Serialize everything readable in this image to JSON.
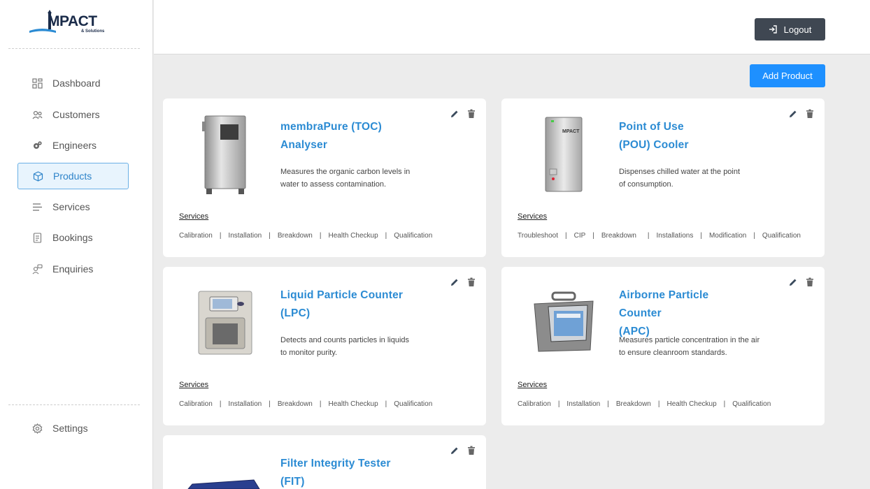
{
  "brand": {
    "name": "MPACT",
    "tagline": "& Solutions"
  },
  "sidebar": {
    "items": [
      {
        "label": "Dashboard",
        "icon": "grid-icon"
      },
      {
        "label": "Customers",
        "icon": "users-icon"
      },
      {
        "label": "Engineers",
        "icon": "gears-icon"
      },
      {
        "label": "Products",
        "icon": "box-icon",
        "active": true
      },
      {
        "label": "Services",
        "icon": "list-icon"
      },
      {
        "label": "Bookings",
        "icon": "document-icon"
      },
      {
        "label": "Enquiries",
        "icon": "chat-user-icon"
      }
    ],
    "settings": {
      "label": "Settings",
      "icon": "gear-icon"
    }
  },
  "header": {
    "logout_label": "Logout"
  },
  "toolbar": {
    "add_product_label": "Add Product"
  },
  "services_heading": "Services",
  "products": [
    {
      "title_line1": "membraPure (TOC)",
      "title_line2": "Analyser",
      "desc_line1": "Measures the organic carbon levels in",
      "desc_line2": "water to assess contamination.",
      "services": [
        "Calibration",
        "Installation",
        "Breakdown",
        "Health Checkup",
        "Qualification"
      ]
    },
    {
      "title_line1": "Point of Use",
      "title_line2": "(POU) Cooler",
      "desc_line1": "Dispenses chilled water at the point",
      "desc_line2": "of consumption.",
      "services": [
        "Troubleshoot",
        "CIP",
        "Breakdown",
        "Installations",
        "Modification",
        "Qualification"
      ]
    },
    {
      "title_line1": "Liquid Particle Counter",
      "title_line2": "(LPC)",
      "desc_line1": "Detects and counts particles in liquids",
      "desc_line2": "to monitor purity.",
      "services": [
        "Calibration",
        "Installation",
        "Breakdown",
        "Health Checkup",
        "Qualification"
      ]
    },
    {
      "title_line1": "Airborne Particle Counter",
      "title_line2": "(APC)",
      "desc_line1": "Measures particle concentration in the air",
      "desc_line2": "to ensure cleanroom standards.",
      "services": [
        "Calibration",
        "Installation",
        "Breakdown",
        "Health Checkup",
        "Qualification"
      ]
    },
    {
      "title_line1": "Filter Integrity Tester",
      "title_line2": "(FIT)",
      "desc_line1": "",
      "desc_line2": "",
      "services": []
    }
  ]
}
